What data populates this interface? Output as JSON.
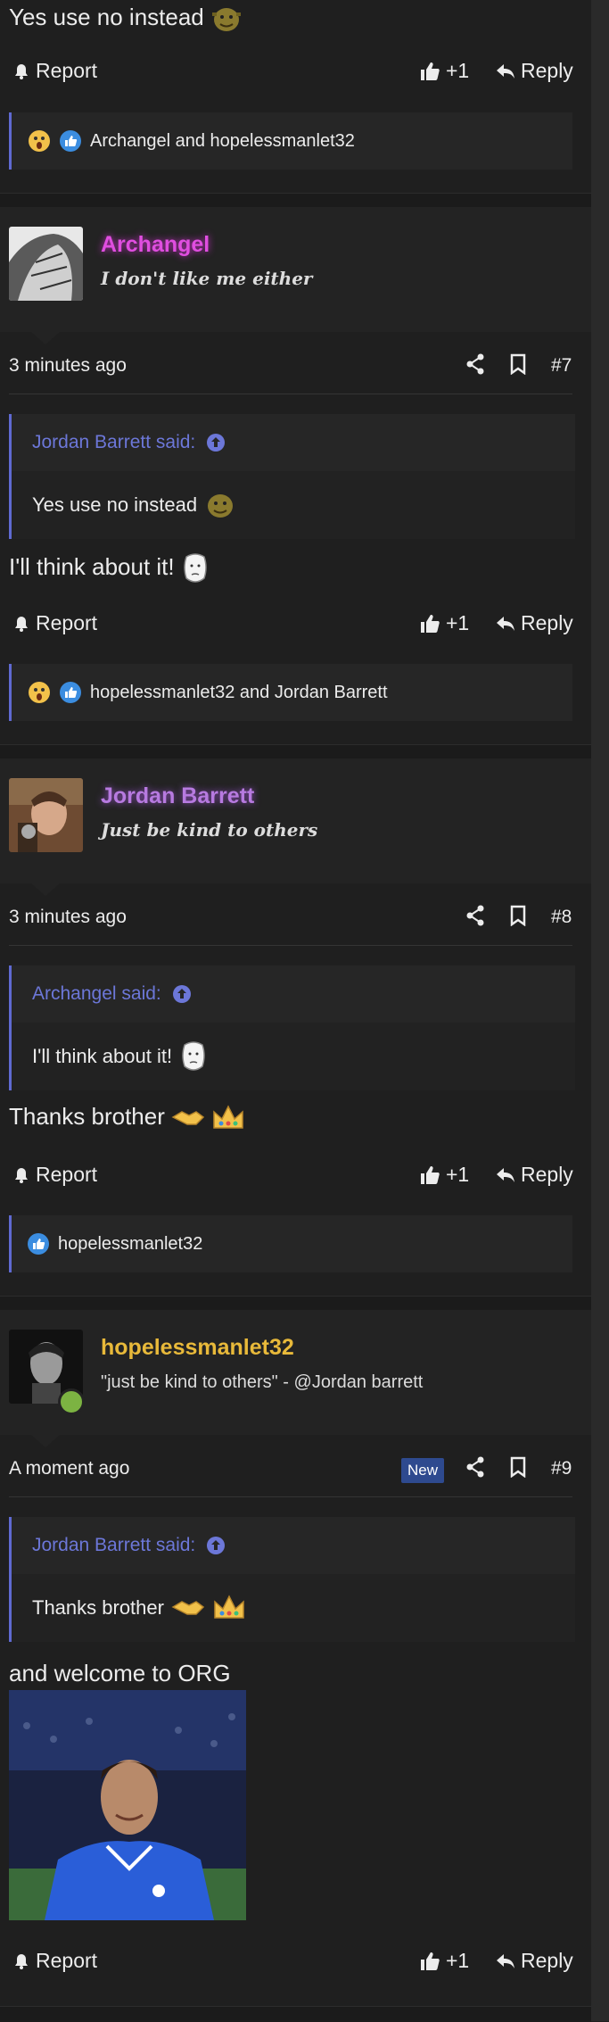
{
  "post6": {
    "body": "Yes use no instead",
    "report": "Report",
    "plus": "+1",
    "reply": "Reply",
    "reactions": "Archangel and hopelessmanlet32"
  },
  "post7": {
    "username": "Archangel",
    "user_title": "I don't like me either",
    "time": "3 minutes ago",
    "num": "#7",
    "quote_author": "Jordan Barrett said:",
    "quote_text": "Yes use no instead",
    "body": "I'll think about it!",
    "report": "Report",
    "plus": "+1",
    "reply": "Reply",
    "reactions": "hopelessmanlet32 and Jordan Barrett"
  },
  "post8": {
    "username": "Jordan Barrett",
    "user_title": "Just be kind to others",
    "time": "3 minutes ago",
    "num": "#8",
    "quote_author": "Archangel said:",
    "quote_text": "I'll think about it!",
    "body": "Thanks brother",
    "report": "Report",
    "plus": "+1",
    "reply": "Reply",
    "reactions": "hopelessmanlet32"
  },
  "post9": {
    "username": "hopelessmanlet32",
    "user_title": "\"just be kind to others\" - @Jordan barrett",
    "time": "A moment ago",
    "badge": "New",
    "num": "#9",
    "quote_author": "Jordan Barrett said:",
    "quote_text": "Thanks brother",
    "body": "and welcome to ORG",
    "report": "Report",
    "plus": "+1",
    "reply": "Reply"
  },
  "colors": {
    "background": "#1f1f1f",
    "accent": "#5f6ad1",
    "archangel_name": "#e04ee0",
    "jordan_name": "#b77ae0",
    "hopeless_name": "#e8b93a",
    "new_badge": "#2e4a8f"
  }
}
